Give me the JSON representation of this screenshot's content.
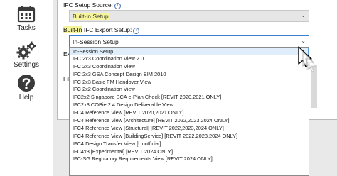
{
  "sidebar": {
    "items": [
      {
        "label": "Tasks",
        "icon": "tasks-icon"
      },
      {
        "label": "Settings",
        "icon": "gears-icon"
      },
      {
        "label": "Help",
        "icon": "help-icon"
      }
    ]
  },
  "form": {
    "setup_source_label": "IFC Setup Source:",
    "setup_source_value": "Built-in Setup",
    "export_setup_label_highlight": "Built-In",
    "export_setup_label_rest": " IFC Export Setup:",
    "export_setup_value": "In-Session Setup",
    "partial_label_1": "Exp",
    "partial_label_2": "File"
  },
  "dropdown": {
    "options": [
      "In-Session Setup",
      "IFC 2x3 Coordination View 2.0",
      "IFC 2x3 Coordination View",
      "IFC 2x3 GSA Concept Design BIM 2010",
      "IFC 2x3 Basic FM Handover View",
      "IFC 2x2 Coordination View",
      "IFC2x2 Singapore BCA e-Plan Check [REVIT 2020,2021 ONLY]",
      "IFC2x3 COBie 2.4 Design Deliverable View",
      "IFC4 Reference View [REVIT 2020,2021 ONLY]",
      "IFC4 Reference View [Architecture] [REVIT 2022,2023,2024 ONLY]",
      "IFC4 Reference View [Structural] [REVIT 2022,2023,2024 ONLY]",
      "IFC4 Reference View [BuildingService] [REVIT 2022,2023,2024 ONLY]",
      "IFC4 Design Transfer View [Unofficial]",
      "IFC4x3 [Experimental] [REVIT 2024 ONLY]",
      "IFC-SG Regulatory Requirements View [REVIT 2024 ONLY]"
    ],
    "selected_index": 0
  },
  "colors": {
    "highlight": "#f6f59a",
    "focus_border": "#3c7fd0",
    "selected_option_bg": "#dfeefa"
  }
}
